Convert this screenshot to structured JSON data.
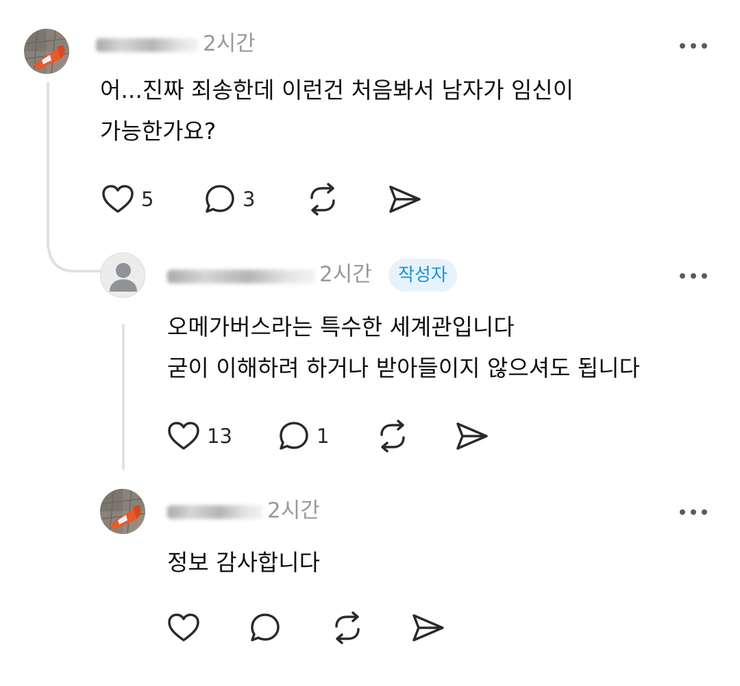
{
  "comments": [
    {
      "time": "2시간",
      "lines": [
        "어...진짜 죄송한데 이런건 처음봐서 남자가 임신이",
        "가능한가요?"
      ],
      "likes": "5",
      "replies": "3"
    },
    {
      "time": "2시간",
      "badge": "작성자",
      "lines": [
        "오메가버스라는 특수한 세계관입니다",
        "굳이 이해하려 하거나 받아들이지 않으셔도 됩니다"
      ],
      "likes": "13",
      "replies": "1"
    },
    {
      "time": "2시간",
      "lines": [
        "정보 감사합니다"
      ],
      "likes": "",
      "replies": ""
    }
  ],
  "icons": {
    "like": "heart-icon",
    "reply": "speech-bubble-icon",
    "repost": "repost-icon",
    "share": "send-icon",
    "more": "more-dots-icon"
  },
  "colors": {
    "badge_bg": "#e6f3fd",
    "badge_text": "#1d8fd6",
    "time_text": "#999999",
    "thread_line": "#e1e1e1"
  }
}
